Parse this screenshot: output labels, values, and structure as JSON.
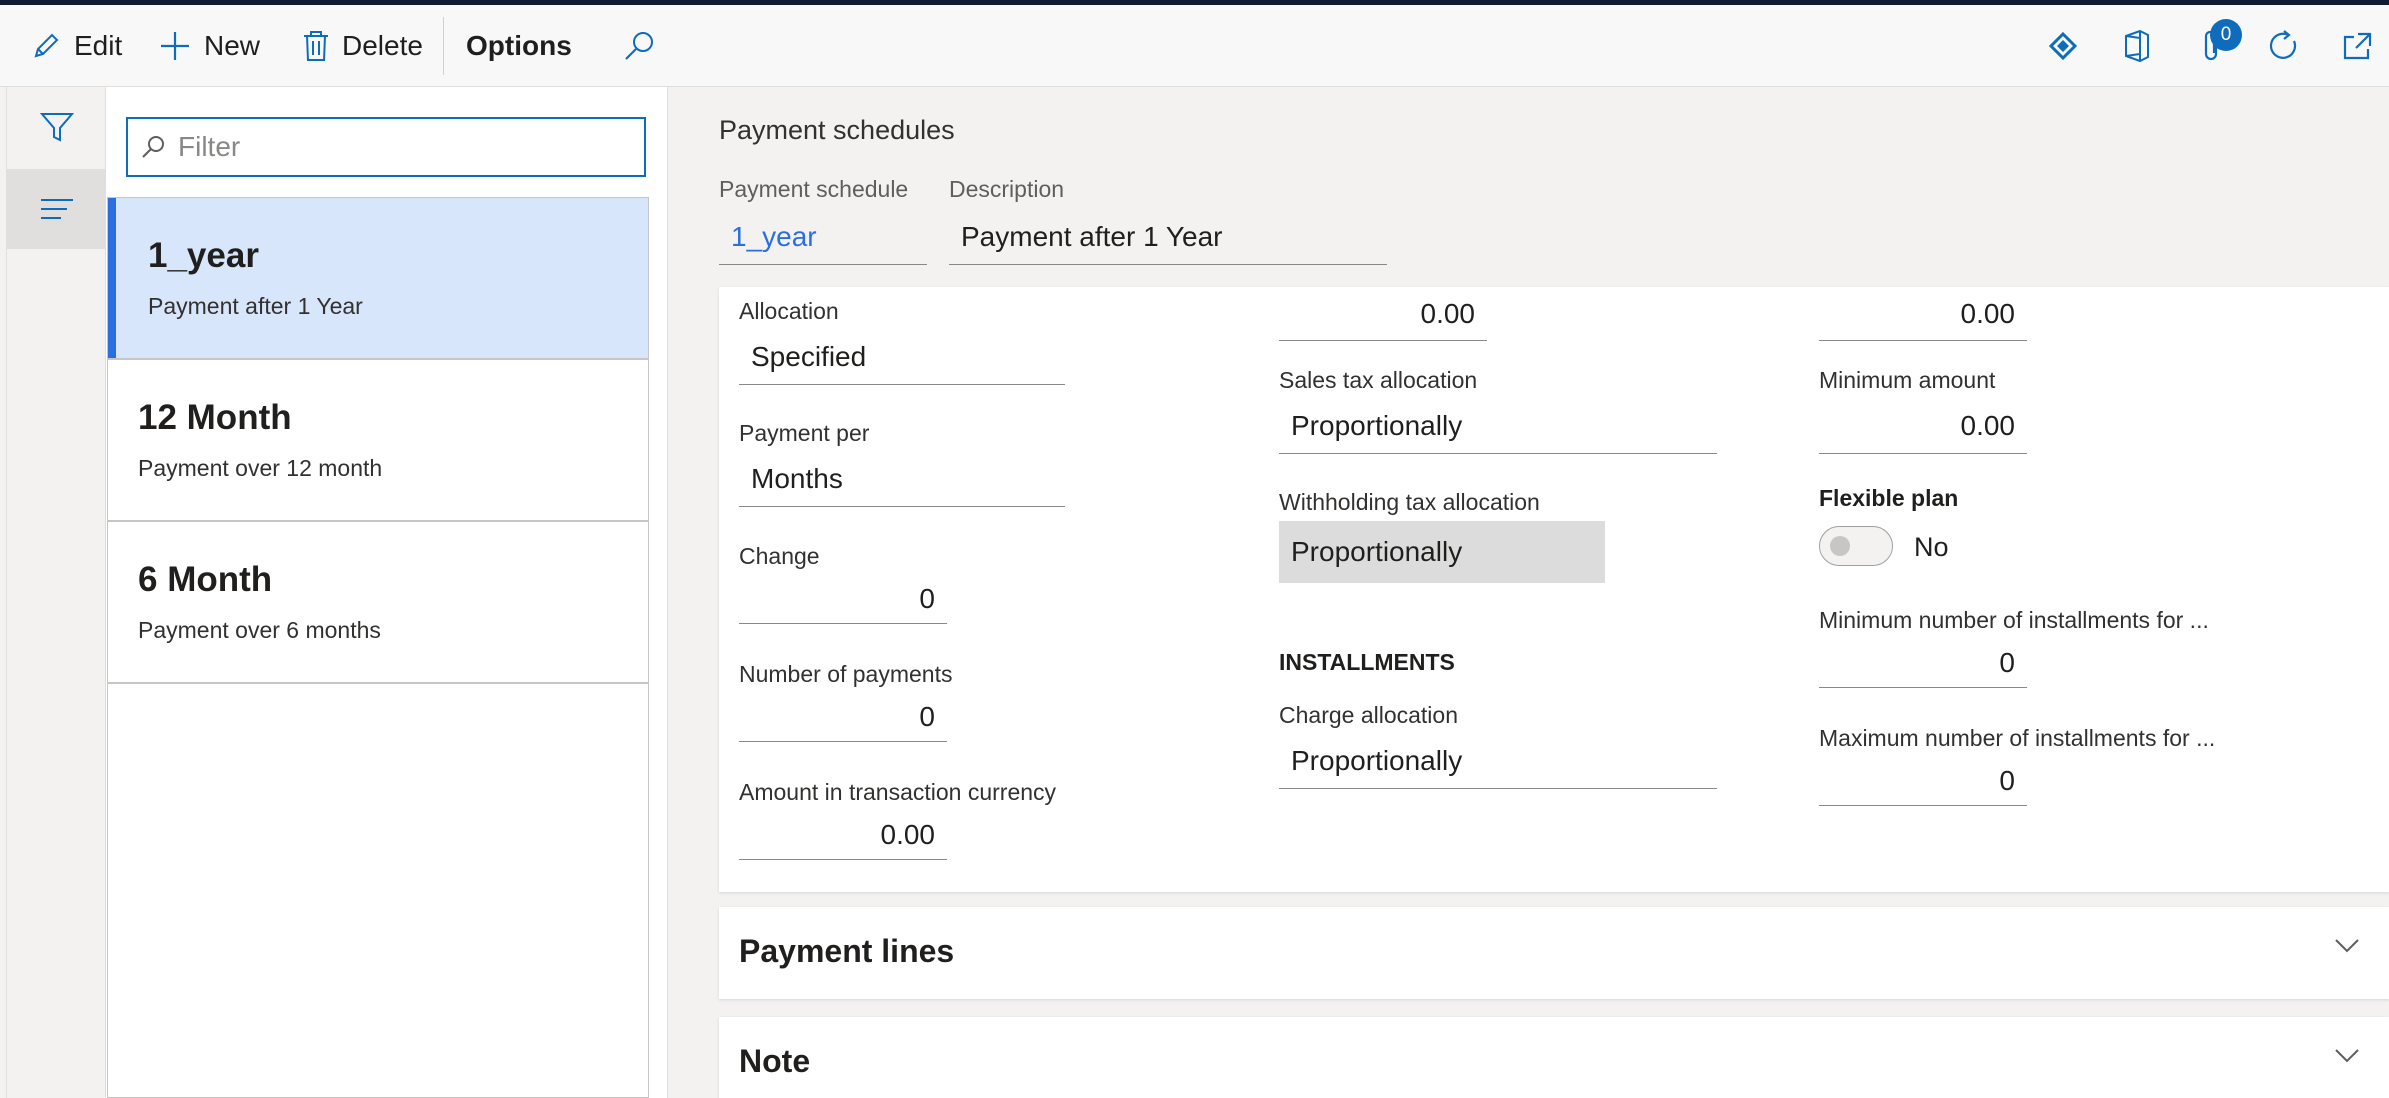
{
  "toolbar": {
    "edit_label": "Edit",
    "new_label": "New",
    "delete_label": "Delete",
    "options_label": "Options",
    "attachments_count": "0"
  },
  "filter": {
    "placeholder": "Filter"
  },
  "list": {
    "items": [
      {
        "title": "1_year",
        "subtitle": "Payment after 1 Year",
        "selected": true
      },
      {
        "title": "12 Month",
        "subtitle": "Payment over 12 month",
        "selected": false
      },
      {
        "title": "6 Month",
        "subtitle": "Payment over 6 months",
        "selected": false
      }
    ]
  },
  "header": {
    "section_title": "Payment schedules",
    "payment_schedule_label": "Payment schedule",
    "payment_schedule_value": "1_year",
    "description_label": "Description",
    "description_value": "Payment after 1 Year"
  },
  "form": {
    "allocation_label": "Allocation",
    "allocation_value": "Specified",
    "payment_per_label": "Payment per",
    "payment_per_value": "Months",
    "change_label": "Change",
    "change_value": "0",
    "number_of_payments_label": "Number of payments",
    "number_of_payments_value": "0",
    "amount_label": "Amount in transaction currency",
    "amount_value": "0.00",
    "col2_top_value": "0.00",
    "sales_tax_label": "Sales tax allocation",
    "sales_tax_value": "Proportionally",
    "withholding_tax_label": "Withholding tax allocation",
    "withholding_tax_value": "Proportionally",
    "installments_heading": "INSTALLMENTS",
    "charge_allocation_label": "Charge allocation",
    "charge_allocation_value": "Proportionally",
    "col3_top_value": "0.00",
    "minimum_amount_label": "Minimum amount",
    "minimum_amount_value": "0.00",
    "flexible_plan_label": "Flexible plan",
    "flexible_plan_value": "No",
    "min_installments_label": "Minimum number of installments for ...",
    "min_installments_value": "0",
    "max_installments_label": "Maximum number of installments for ...",
    "max_installments_value": "0"
  },
  "fasttabs": {
    "payment_lines": "Payment lines",
    "note": "Note"
  },
  "colors": {
    "accent": "#0f6cbd",
    "link": "#2b6ee0",
    "selected_bg": "#d7e6fa"
  }
}
